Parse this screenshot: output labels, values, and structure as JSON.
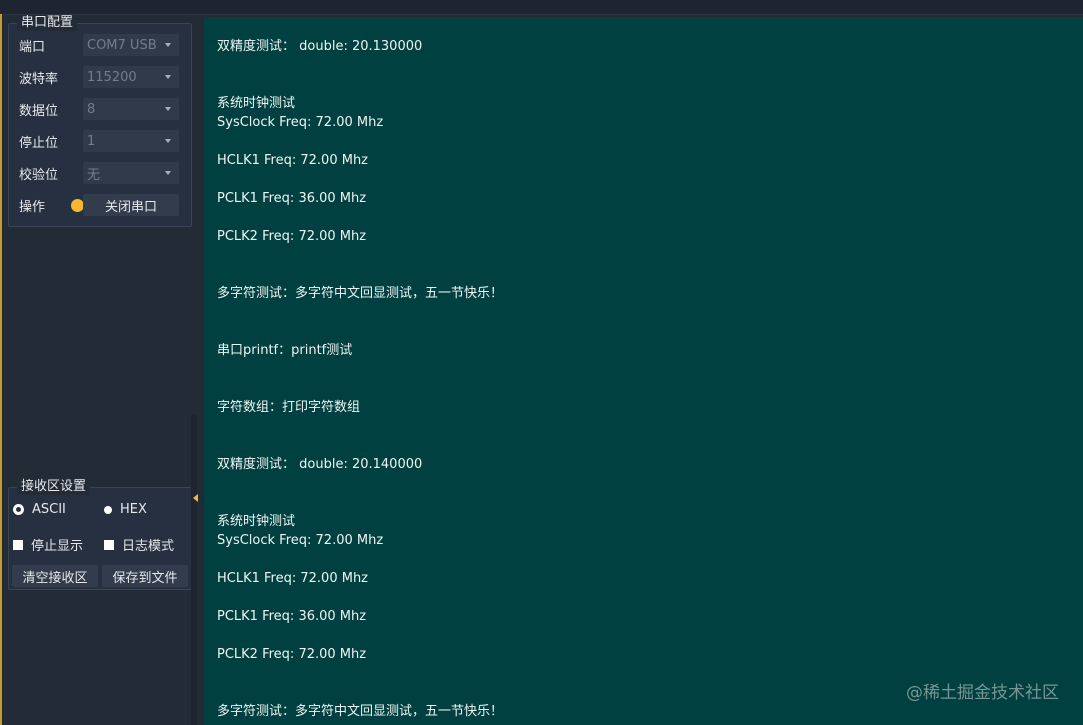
{
  "serial_config": {
    "title": "串口配置",
    "port": {
      "label": "端口",
      "value": "COM7 USB"
    },
    "baud": {
      "label": "波特率",
      "value": "115200"
    },
    "data_bits": {
      "label": "数据位",
      "value": "8"
    },
    "stop_bits": {
      "label": "停止位",
      "value": "1"
    },
    "parity": {
      "label": "校验位",
      "value": "无"
    },
    "operation": {
      "label": "操作",
      "button": "关闭串口",
      "status_color": "#f7b731"
    }
  },
  "receive_settings": {
    "title": "接收区设置",
    "ascii": "ASCII",
    "hex": "HEX",
    "stop_display": "停止显示",
    "log_mode": "日志模式",
    "clear_button": "清空接收区",
    "save_button": "保存到文件"
  },
  "console": {
    "lines": [
      "双精度测试： double: 20.130000",
      "系统时钟测试",
      "SysClock Freq: 72.00 Mhz",
      "HCLK1 Freq: 72.00 Mhz",
      "PCLK1 Freq: 36.00 Mhz",
      "PCLK2 Freq: 72.00 Mhz",
      "多字符测试：多字符中文回显测试，五一节快乐！",
      "串口printf：printf测试",
      "字符数组：打印字符数组",
      "双精度测试： double: 20.140000",
      "系统时钟测试",
      "SysClock Freq: 72.00 Mhz",
      "HCLK1 Freq: 72.00 Mhz",
      "PCLK1 Freq: 36.00 Mhz",
      "PCLK2 Freq: 72.00 Mhz",
      "多字符测试：多字符中文回显测试，五一节快乐！"
    ]
  },
  "watermark": "@稀土掘金技术社区",
  "colors": {
    "console_bg": "#004040",
    "sidebar_bg": "#232b37",
    "accent": "#f7b731"
  }
}
